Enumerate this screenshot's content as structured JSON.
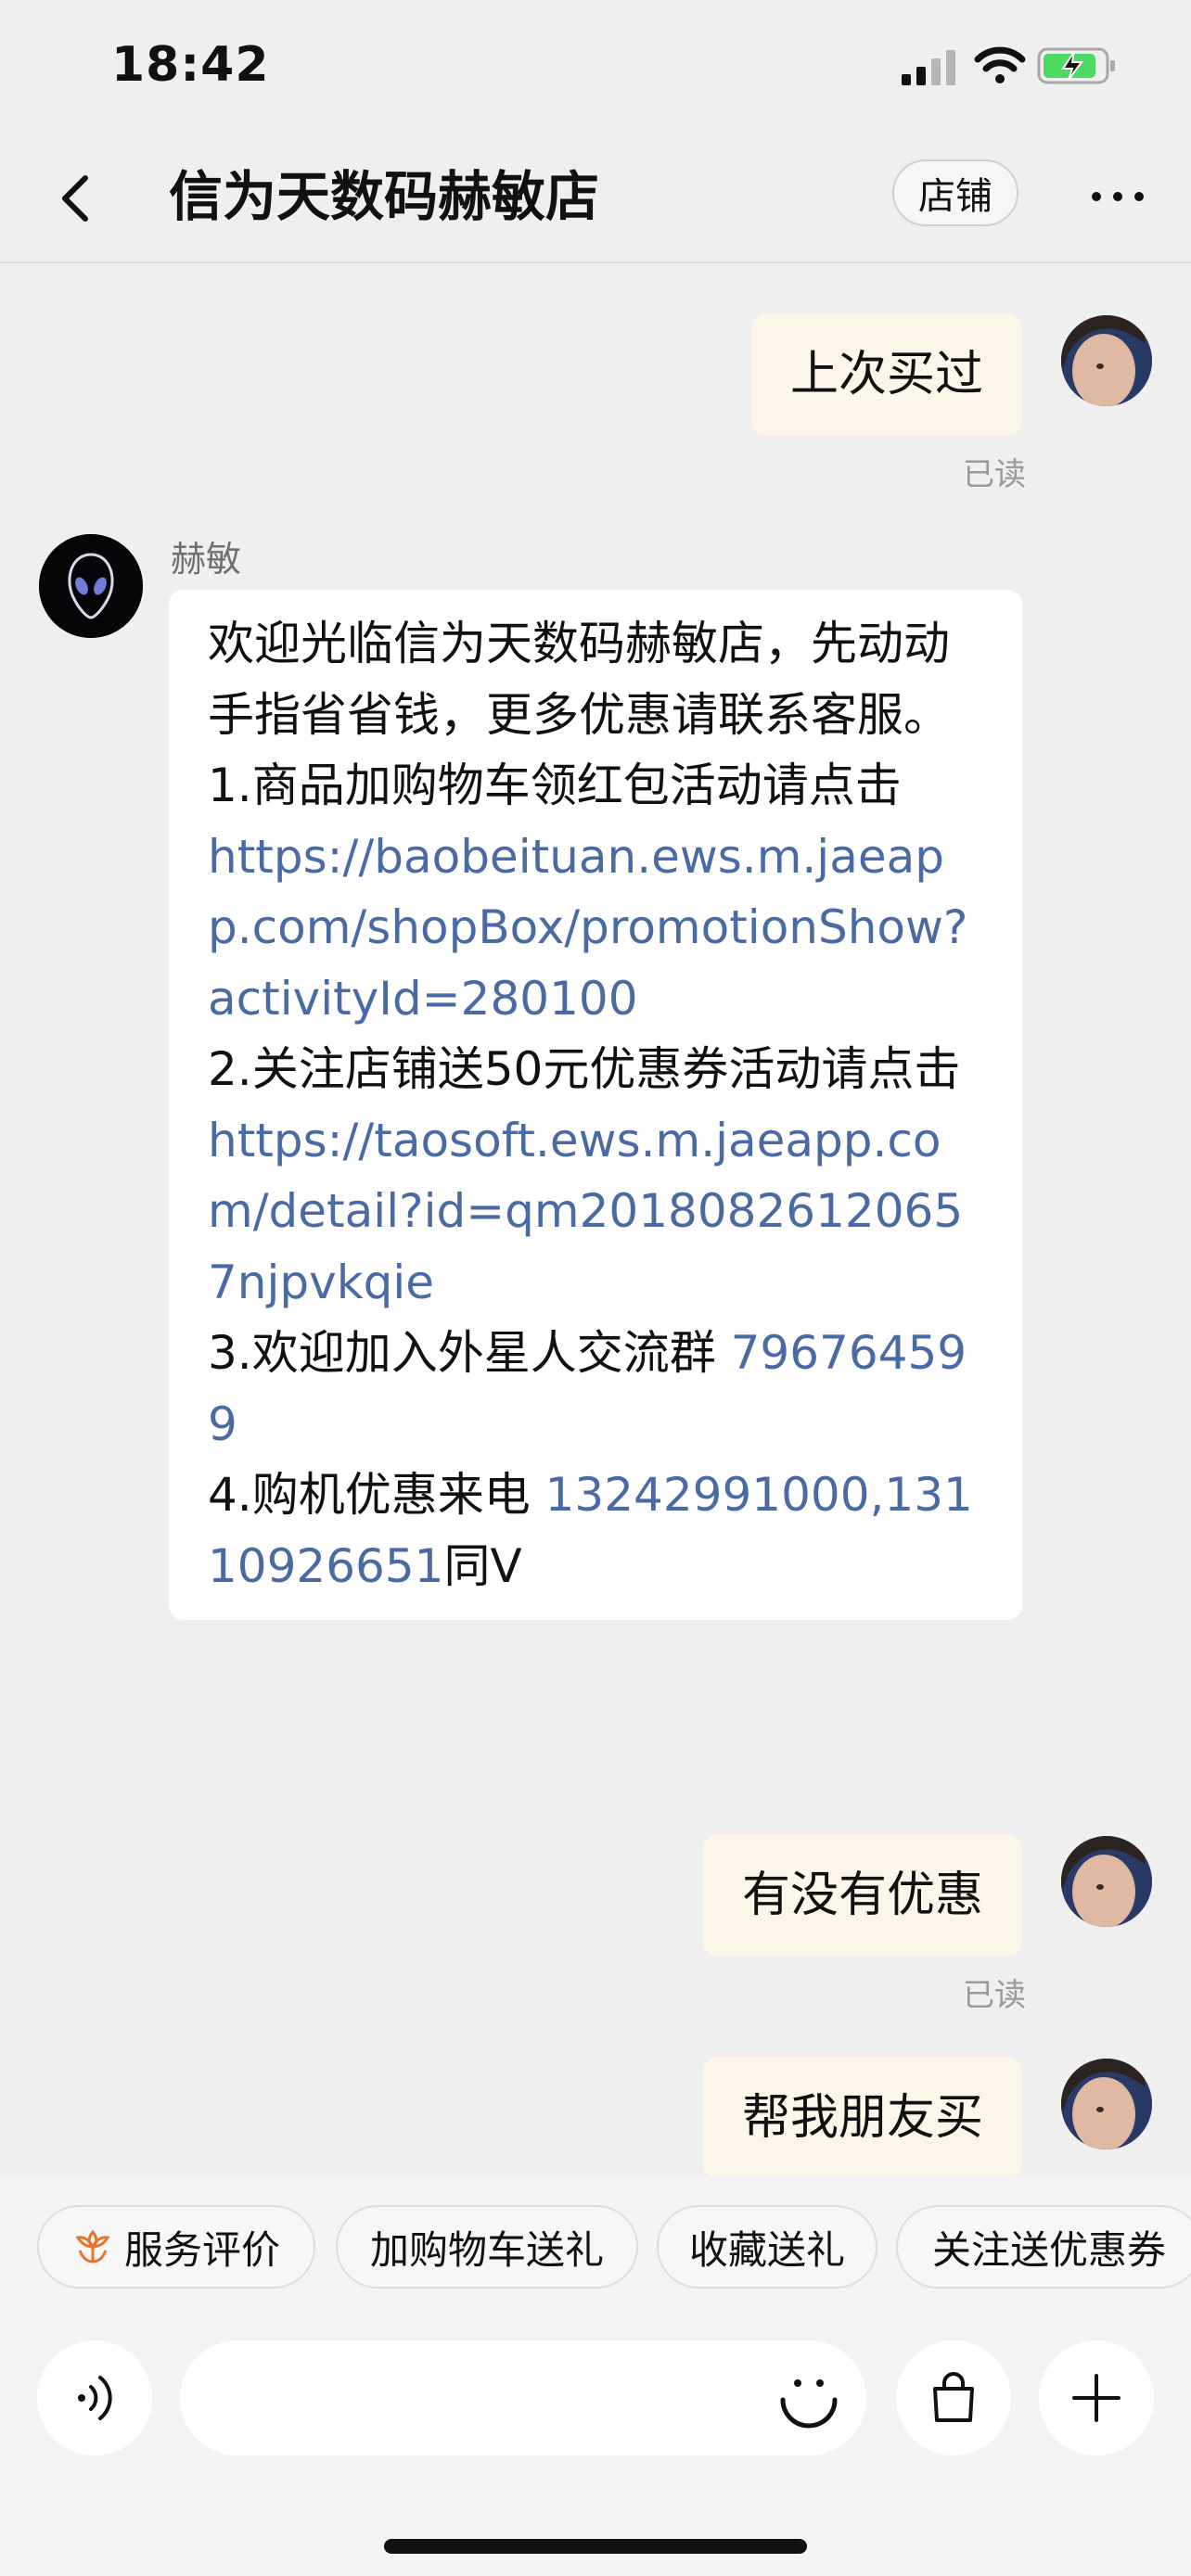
{
  "status_bar": {
    "time": "18:42"
  },
  "nav": {
    "title": "信为天数码赫敏店",
    "shop_label": "店铺"
  },
  "messages": {
    "m1": {
      "text": "上次买过",
      "read": "已读"
    },
    "m2": {
      "sender": "赫敏",
      "lines": [
        {
          "text": "欢迎光临信为天数码赫敏店，先动动手指省省钱，更多优惠请联系客服。"
        },
        {
          "text": "1.商品加购物车领红包活动请点击"
        },
        {
          "link": "https://baobeituan.ews.m.jaeapp.com/shopBox/promotionShow?activityId=280100"
        },
        {
          "text": "2.关注店铺送50元优惠券活动请点击"
        },
        {
          "link": "https://taosoft.ews.m.jaeapp.com/detail?id=qm20180826120657njpvkqie"
        },
        {
          "text": "3.欢迎加入外星人交流群 ",
          "link": "796764599"
        },
        {
          "text": "4.购机优惠来电 ",
          "link": "13242991000,13110926651",
          "suffix": "同V"
        }
      ]
    },
    "m3": {
      "text": "有没有优惠",
      "read": "已读"
    },
    "m4": {
      "text": "帮我朋友买"
    }
  },
  "quick_actions": [
    "服务评价",
    "加购物车送礼",
    "收藏送礼",
    "关注送优惠券"
  ],
  "input": {
    "placeholder": ""
  },
  "colors": {
    "link": "#4a6aa5",
    "outgoing_bubble": "#fbf6e8",
    "background": "#efefef",
    "accent": "#e8742b"
  }
}
